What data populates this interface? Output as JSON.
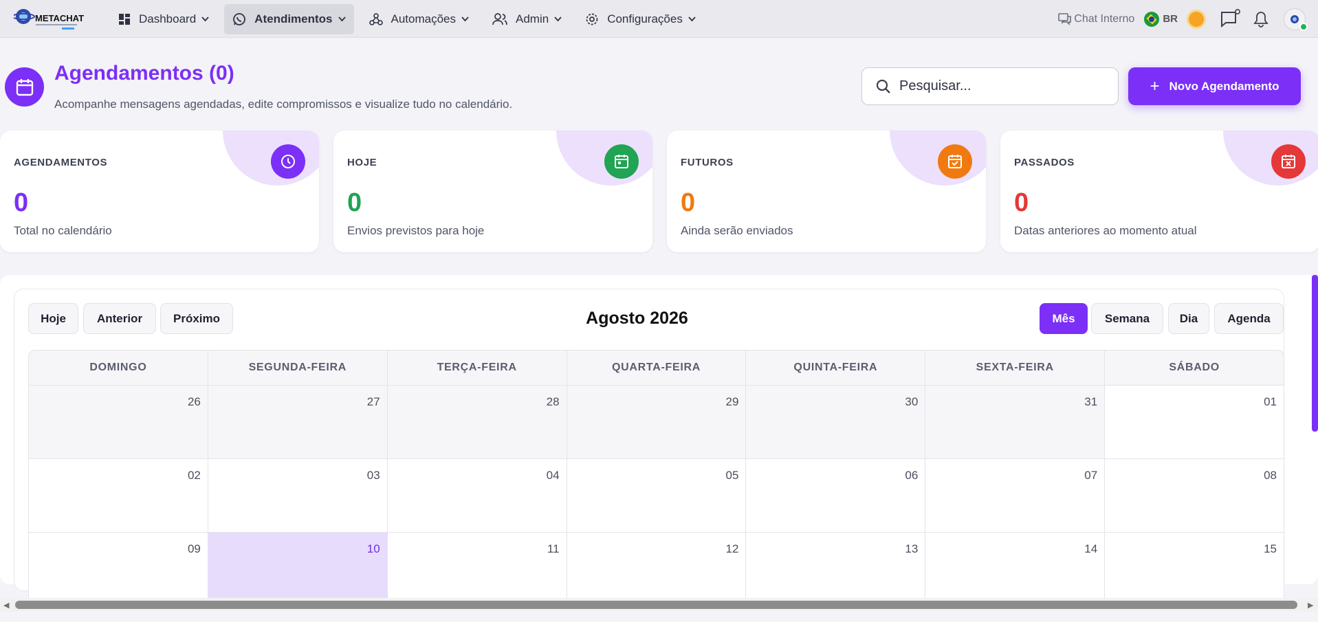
{
  "topbar": {
    "logo_text": "METACHAT",
    "nav": [
      {
        "label": "Dashboard",
        "icon": "dashboard-icon"
      },
      {
        "label": "Atendimentos",
        "icon": "whatsapp-icon",
        "active": true
      },
      {
        "label": "Automações",
        "icon": "webhook-icon"
      },
      {
        "label": "Admin",
        "icon": "users-icon"
      },
      {
        "label": "Configurações",
        "icon": "gear-icon"
      }
    ],
    "chat_interno": "Chat Interno",
    "lang": "BR"
  },
  "header": {
    "title": "Agendamentos (0)",
    "subtitle": "Acompanhe mensagens agendadas, edite compromissos e visualize tudo no calendário.",
    "search_placeholder": "Pesquisar...",
    "new_button": "Novo Agendamento"
  },
  "stats": [
    {
      "label": "AGENDAMENTOS",
      "value": "0",
      "desc": "Total no calendário",
      "color": "#7b2ff7"
    },
    {
      "label": "HOJE",
      "value": "0",
      "desc": "Envios previstos para hoje",
      "color": "#21a453"
    },
    {
      "label": "FUTUROS",
      "value": "0",
      "desc": "Ainda serão enviados",
      "color": "#f17a10"
    },
    {
      "label": "PASSADOS",
      "value": "0",
      "desc": "Datas anteriores ao momento atual",
      "color": "#e53838"
    }
  ],
  "calendar": {
    "nav_buttons": [
      "Hoje",
      "Anterior",
      "Próximo"
    ],
    "title": "Agosto 2026",
    "views": [
      "Mês",
      "Semana",
      "Dia",
      "Agenda"
    ],
    "active_view": "Mês",
    "weekdays": [
      "DOMINGO",
      "SEGUNDA-FEIRA",
      "TERÇA-FEIRA",
      "QUARTA-FEIRA",
      "QUINTA-FEIRA",
      "SEXTA-FEIRA",
      "SÁBADO"
    ],
    "weeks": [
      [
        "26",
        "27",
        "28",
        "29",
        "30",
        "31",
        "01"
      ],
      [
        "02",
        "03",
        "04",
        "05",
        "06",
        "07",
        "08"
      ],
      [
        "09",
        "10",
        "11",
        "12",
        "13",
        "14",
        "15"
      ]
    ],
    "today": "10"
  }
}
